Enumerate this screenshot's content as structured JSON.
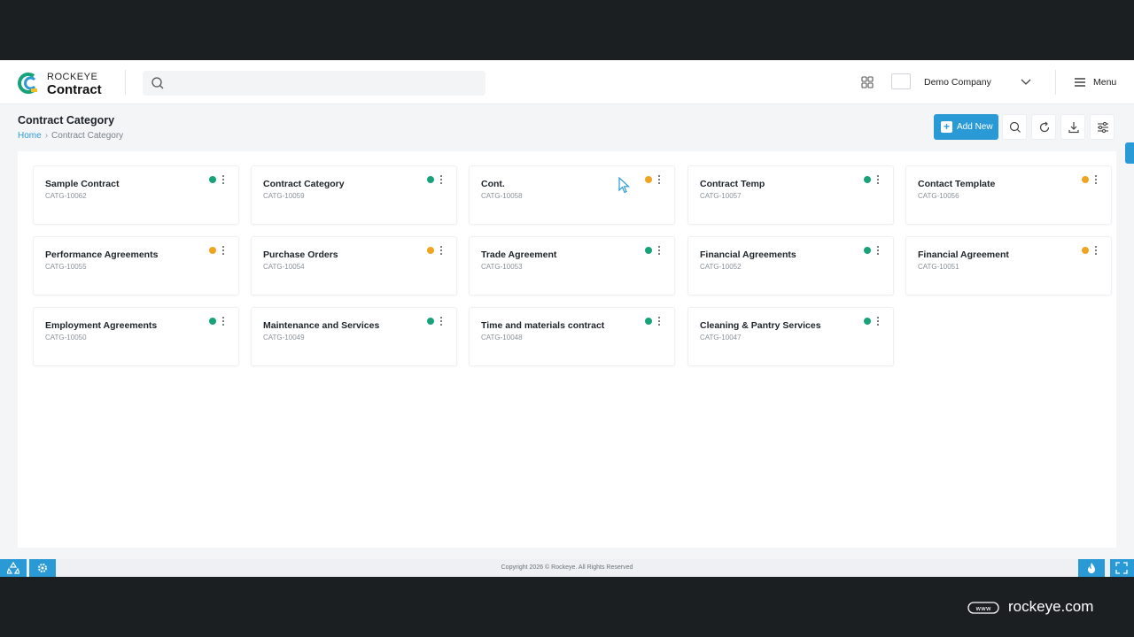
{
  "brand": {
    "top": "ROCKEYE",
    "bottom": "Contract"
  },
  "header": {
    "company": "Demo Company",
    "menu_label": "Menu",
    "search_placeholder": ""
  },
  "page": {
    "title": "Contract Category",
    "breadcrumb_home": "Home",
    "breadcrumb_current": "Contract Category"
  },
  "toolbar": {
    "add_new": "Add New"
  },
  "colors": {
    "accent": "#2a9ad6",
    "green": "#16a37a",
    "orange": "#f2a320"
  },
  "cards": [
    {
      "name": "Sample Contract",
      "code": "CATG-10062",
      "status": "green"
    },
    {
      "name": "Contract Category",
      "code": "CATG-10059",
      "status": "green"
    },
    {
      "name": "Cont.",
      "code": "CATG-10058",
      "status": "orange"
    },
    {
      "name": "Contract Temp",
      "code": "CATG-10057",
      "status": "green"
    },
    {
      "name": "Contact Template",
      "code": "CATG-10056",
      "status": "orange"
    },
    {
      "name": "Performance Agreements",
      "code": "CATG-10055",
      "status": "orange"
    },
    {
      "name": "Purchase Orders",
      "code": "CATG-10054",
      "status": "orange"
    },
    {
      "name": "Trade Agreement",
      "code": "CATG-10053",
      "status": "green"
    },
    {
      "name": "Financial Agreements",
      "code": "CATG-10052",
      "status": "green"
    },
    {
      "name": "Financial Agreement",
      "code": "CATG-10051",
      "status": "orange"
    },
    {
      "name": "Employment Agreements",
      "code": "CATG-10050",
      "status": "green"
    },
    {
      "name": "Maintenance and Services",
      "code": "CATG-10049",
      "status": "green"
    },
    {
      "name": "Time and materials contract",
      "code": "CATG-10048",
      "status": "green"
    },
    {
      "name": "Cleaning & Pantry Services",
      "code": "CATG-10047",
      "status": "green"
    }
  ],
  "footer": {
    "copyright": "Copyright 2026 © Rockeye. All Rights Reserved"
  },
  "watermark": {
    "text": "rockeye.com"
  }
}
